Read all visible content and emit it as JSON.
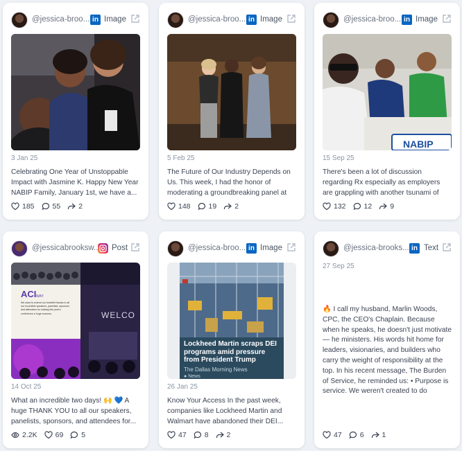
{
  "cards": [
    {
      "handle": "@jessica-broo...",
      "platform": "linkedin",
      "type": "Image",
      "date": "3 Jan 25",
      "text": "Celebrating One Year of Unstoppable Impact with Jasmine K. Happy New Year NABIP Family, January 1st, we have a...",
      "likes": "185",
      "comments": "55",
      "shares": "2"
    },
    {
      "handle": "@jessica-broo...",
      "platform": "linkedin",
      "type": "Image",
      "date": "5 Feb 25",
      "text": "The Future of Our Industry Depends on Us. This week, I had the honor of moderating a groundbreaking panel at the California...",
      "likes": "148",
      "comments": "19",
      "shares": "2"
    },
    {
      "handle": "@jessica-broo...",
      "platform": "linkedin",
      "type": "Image",
      "date": "15 Sep 25",
      "text": "There's been a lot of discussion regarding Rx especially as employers are grappling with another tsunami of price hikes. I had...",
      "likes": "132",
      "comments": "12",
      "shares": "9",
      "image_badge": "NABIP"
    },
    {
      "handle": "@jessicabrooksw...",
      "platform": "instagram",
      "type": "Post",
      "date": "14 Oct 25",
      "text": "What an incredible two days! 🙌 💙 A huge THANK YOU to all our speakers, panelists, sponsors, and attendees for...",
      "views": "2.2K",
      "likes": "69",
      "comments": "5",
      "image_texts": {
        "logo": "ACI",
        "logo_sub": "WAY",
        "thanks": "We want to extend our heartfelt thanks to all our incredible speakers, panelists, sponsors and attendees for making this year's conference a huge success.",
        "welcome": "WELCO"
      }
    },
    {
      "handle": "@jessica-broo...",
      "platform": "linkedin",
      "type": "Image",
      "date": "26 Jan 25",
      "text": "Know Your Access In the past week, companies like Lockheed Martin and Walmart have abandoned their DEI...",
      "likes": "47",
      "comments": "8",
      "shares": "2",
      "news": {
        "headline": "Lockheed Martin scraps DEI programs amid pressure from President Trump",
        "source": "The Dallas Morning News",
        "tag": "News"
      }
    },
    {
      "handle": "@jessica-brooks...",
      "platform": "linkedin",
      "type": "Text",
      "date": "27 Sep 25",
      "text": "🔥 I call my husband, Marlin Woods, CPC, the CEO's Chaplain. Because when he speaks, he doesn't just motivate — he ministers. His words hit home for leaders, visionaries, and builders who carry the weight of responsibility at the top. In his recent message, The Burden of Service, he reminded us: • Purpose is service. We weren't created to do anything — we were created to do something. • That burden...",
      "likes": "47",
      "comments": "6",
      "shares": "1"
    }
  ]
}
